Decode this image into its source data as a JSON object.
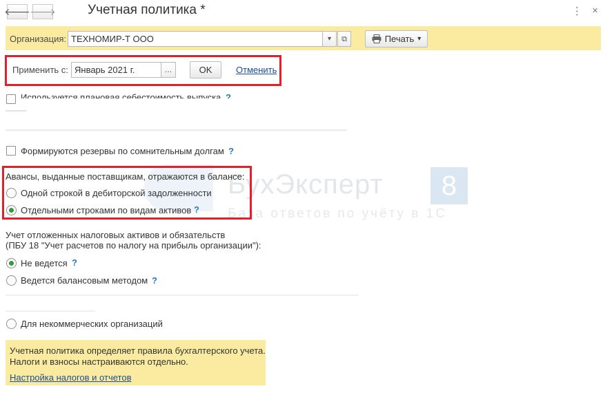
{
  "header": {
    "title": "Учетная политика *",
    "back_glyph": "🡐",
    "forward_glyph": "🡒",
    "kebab_glyph": "⋮"
  },
  "org_bar": {
    "label": "Организация:",
    "value": "ТЕХНОМИР-Т ООО",
    "dropdown_glyph": "▾",
    "open_glyph": "⧉",
    "print_label": "Печать",
    "print_arrow": "▾"
  },
  "apply_bar": {
    "label": "Применить с:",
    "date_value": "Январь 2021 г.",
    "choose_glyph": "...",
    "ok_label": "OK",
    "cancel_link": "Отменить"
  },
  "options": {
    "planned_cost": "Используется плановая себестоимость выпуска",
    "reserves": "Формируются резервы по сомнительным долгам",
    "help": "?"
  },
  "advances": {
    "heading": "Авансы, выданные поставщикам, отражаются в балансе:",
    "option_single": "Одной строкой в дебиторской задолженности",
    "option_separate": "Отдельными строками по видам активов",
    "selected": "separate"
  },
  "deferred_tax": {
    "heading_line1": "Учет отложенных налоговых активов и обязательств",
    "heading_line2": "(ПБУ 18 \"Учет расчетов по налогу на прибыль организации\"):",
    "option_not_used": "Не ведется",
    "option_balance": "Ведется балансовым методом",
    "option_nonprofit": "Для некоммерческих организаций",
    "selected": "not_used"
  },
  "watermark": {
    "brand": "БухЭксперт",
    "badge": "8",
    "tagline": "База ответов по учёту в 1С"
  },
  "info_note": {
    "line1": "Учетная политика определяет правила бухгалтерского учета.",
    "line2": "Налоги и взносы настраиваются отдельно.",
    "link": "Настройка налогов и отчетов"
  },
  "colors": {
    "yellow_panel": "#fbeba0",
    "highlight_red": "#e0202a",
    "link_blue": "#1a4c9a",
    "help_blue": "#2a79c7",
    "radio_green": "#2e9c3a"
  }
}
